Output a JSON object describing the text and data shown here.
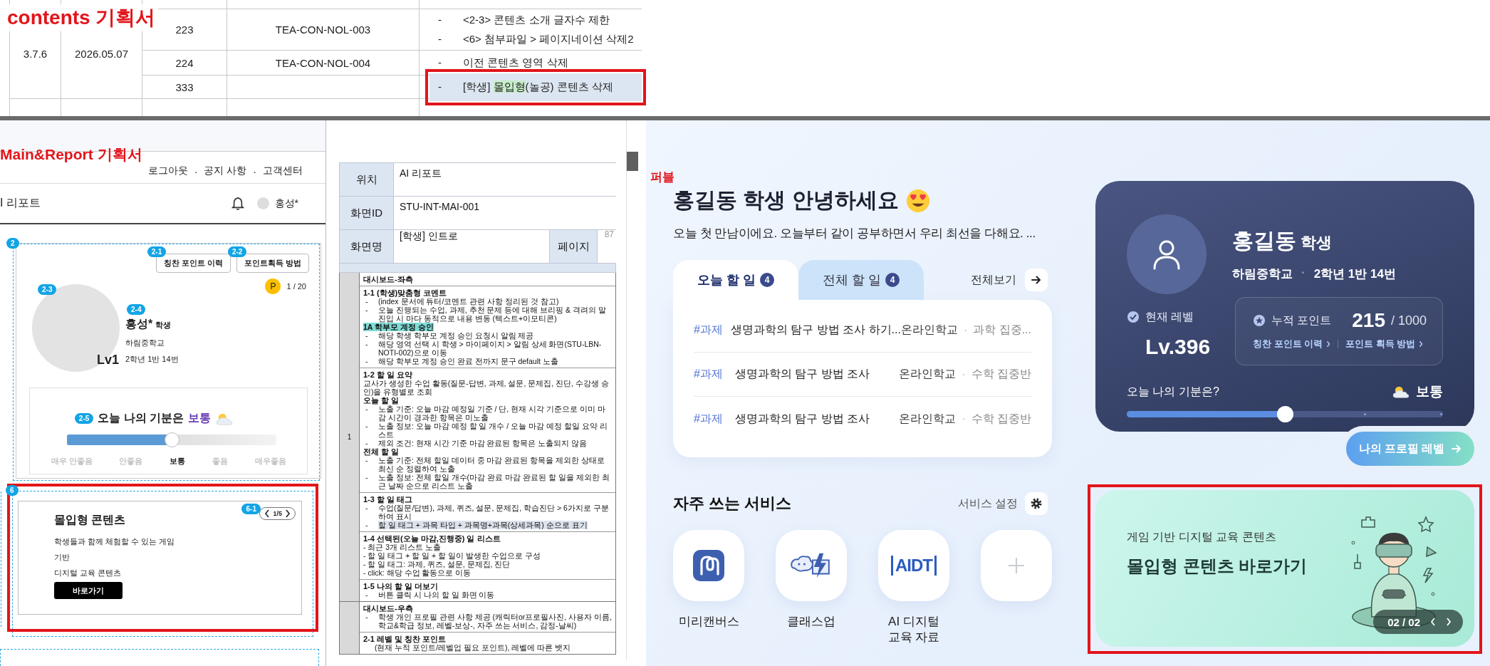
{
  "top_doc": {
    "label": "contents 기획서",
    "version": "3.7.6",
    "date": "2026.05.07",
    "rows": [
      {
        "no": "223",
        "code": "TEA-CON-NOL-003",
        "highlighted": false,
        "changes": [
          {
            "marker": "-",
            "text": "<2-3> 콘텐츠 소개 글자수 제한"
          },
          {
            "marker": "-",
            "text": "<6> 첨부파일 > 페이지네이션 삭제2"
          }
        ]
      },
      {
        "no": "224",
        "code": "TEA-CON-NOL-004",
        "highlighted": false,
        "changes": [
          {
            "marker": "-",
            "text": "이전 콘텐츠 영역 삭제"
          }
        ]
      },
      {
        "no": "333",
        "highlighted": true,
        "changes": [
          {
            "marker": "-",
            "text": "[학생] ",
            "marked": "몰입형",
            "rest": "(놀공) 콘텐츠 삭제"
          }
        ]
      }
    ]
  },
  "wireframe": {
    "label": "Main&Report 기획서",
    "links": [
      "로그아웃",
      "·",
      "공지 사항",
      "·",
      "고객센터"
    ],
    "page_title": "I 리포트",
    "user": "홍성*",
    "profile": {
      "badge": "2",
      "buttons": [
        {
          "badge": "2-1",
          "label": "칭찬 포인트 이력"
        },
        {
          "badge": "2-2",
          "label": "포인트획득 방법"
        }
      ],
      "point_symbol": "P",
      "points": "1 / 20",
      "avatar_badge": "2-3",
      "name_badge": "2-4",
      "name": "홍성*",
      "role": "학생",
      "school": "하림중학교",
      "level": "Lv1",
      "class": "2학년 1반 14번"
    },
    "mood": {
      "badge": "2-5",
      "prompt": "오늘 나의 기분은",
      "value": "보통",
      "level": 0.5,
      "options": [
        {
          "label": "매우 안좋음",
          "selected": false
        },
        {
          "label": "안좋음",
          "selected": false
        },
        {
          "label": "보통",
          "selected": true
        },
        {
          "label": "좋음",
          "selected": false
        },
        {
          "label": "매우좋음",
          "selected": false
        }
      ]
    },
    "content": {
      "badge": "6",
      "pager_badge": "6-1",
      "pager": "1/5",
      "title": "몰입형 콘텐츠",
      "lines": [
        "학생들과 함께 체험할 수 있는 게임",
        "기반",
        "디지털 교육 콘텐츠"
      ],
      "button": "바로가기"
    }
  },
  "spec": {
    "header": [
      {
        "label": "위치",
        "value": "AI 리포트"
      },
      {
        "label": "화면ID",
        "value": "STU-INT-MAI-001"
      }
    ],
    "screen_name": {
      "label": "화면명",
      "value": "[학생] 인트로",
      "page_label": "페이지",
      "page": "87"
    },
    "groups": [
      {
        "number": "1",
        "sections": [
          {
            "lines": [
              {
                "kind": "title",
                "text": "대시보드-좌측"
              }
            ]
          },
          {
            "lines": [
              {
                "kind": "title",
                "text": "1-1 (학생)맞춤형 코멘트"
              },
              {
                "kind": "bullet",
                "marker": "-",
                "text": "(index 문서에 튜터/코멘트 관련 사항 정리된 것 참고)"
              },
              {
                "kind": "bullet",
                "marker": "-",
                "text": "오늘 진행되는 수업, 과제, 추천 문제 등에 대해 브리핑 & 격려의 말 진입 시 마다 동적으로 내용 변동 (텍스트+이모티콘)"
              },
              {
                "kind": "highlight",
                "text": "1A 학부모 계정 승인"
              },
              {
                "kind": "bullet",
                "marker": "-",
                "text": "해당 학생 학부모 계정 승인 요청시 알림 제공"
              },
              {
                "kind": "bullet",
                "marker": "-",
                "text": "해당 영역 선택 시 학생 > 마이페이지 > 알림 상세 화면(STU-LBN-NOTI-002)으로 이동"
              },
              {
                "kind": "bullet",
                "marker": "-",
                "text": "해당 학부모 계정 승인 완료 전까지 문구 default 노출"
              }
            ]
          },
          {
            "lines": [
              {
                "kind": "title",
                "text": "1-2 할 일 요약"
              },
              {
                "kind": "plain",
                "text": "교사가 생성한 수업 활동(질문-답변, 과제, 설문, 문제집, 진단, 수강생 승인)을 유형별로 조회"
              },
              {
                "kind": "title",
                "text": "오늘 할 일"
              },
              {
                "kind": "bullet",
                "marker": "-",
                "text": "노출 기준: 오늘 마감 예정일 기준 / 단, 현재 시각 기준으로 이미 마감 시간이 경과한 항목은 미노출"
              },
              {
                "kind": "bullet",
                "marker": "-",
                "text": "노출 정보: 오늘 마감 예정 할 일 개수 / 오늘 마감 예정 할일 요약 리스트"
              },
              {
                "kind": "bullet",
                "marker": "-",
                "text": "제외 조건: 현재 시간 기준 마감 완료된 항목은 노출되지 않음"
              },
              {
                "kind": "title",
                "text": "전체 할 일"
              },
              {
                "kind": "bullet",
                "marker": "-",
                "text": "노출 기준: 전체 할일 데이터 중 마감 완료된 항목을 제외한 상태로 최신 순 정렬하여 노출"
              },
              {
                "kind": "bullet",
                "marker": "-",
                "text": "노출 정보: 전체 할일 개수(마감 완료 마감 완료된 할 일을 제외한 최근 날짜 순으로 리스트 노출"
              }
            ]
          },
          {
            "lines": [
              {
                "kind": "title",
                "text": "1-3 할 일 태그"
              },
              {
                "kind": "bullet",
                "marker": "-",
                "text": "수업(질문/답변), 과제, 퀴즈, 설문, 문제집, 학습진단 > 6가지로 구분하여 표시"
              },
              {
                "kind": "shaded-bullet",
                "marker": "-",
                "text": "할 일 태그 + 과목 타입 + 과목명+과목(상세과목) 순으로 표기"
              }
            ]
          },
          {
            "lines": [
              {
                "kind": "title",
                "text": "1-4 선택된(오늘 마감,진행중) 일 리스트"
              },
              {
                "kind": "plain",
                "text": "- 최근 3개 리스트 노출"
              },
              {
                "kind": "plain",
                "text": "- 할 일 태그 + 할 일 + 할 일이 발생한 수업으로 구성"
              },
              {
                "kind": "plain",
                "text": "- 할 일 태그: 과제, 퀴즈, 설문, 문제집, 진단"
              },
              {
                "kind": "plain",
                "text": "- click: 해당 수업 활동으로 이동"
              }
            ]
          },
          {
            "lines": [
              {
                "kind": "title",
                "text": "1-5 나의 할 일 더보기"
              },
              {
                "kind": "bullet",
                "marker": "-",
                "text": "버튼 클릭 시 나의 할 일 화면 이동"
              }
            ]
          }
        ]
      },
      {
        "sections": [
          {
            "lines": [
              {
                "kind": "title",
                "text": "대시보드-우측"
              },
              {
                "kind": "bullet",
                "marker": "-",
                "text": "학생 개인 프로필 관련 사항 제공 (캐릭터or프로필사진, 사용자 이름, 학교&학급 정보, 레벨-보상-, 자주 쓰는 서비스, 감정-날씨)"
              }
            ]
          },
          {
            "lines": [
              {
                "kind": "title",
                "text": "2-1 레벨 및 칭찬 포인트"
              },
              {
                "kind": "indent",
                "text": "(현재 누적 포인트/레벨업 필요 포인트), 레벨에 따른 뱃지"
              }
            ]
          }
        ]
      }
    ]
  },
  "app": {
    "label": "퍼블",
    "greeting": "홍길동 학생 안녕하세요",
    "intro": "오늘 첫 만남이에요. 오늘부터 같이 공부하면서 우리 최선을 다해요. ...",
    "tabs": [
      {
        "label": "오늘 할 일",
        "count": "4",
        "selected": true
      },
      {
        "label": "전체 할 일",
        "count": "4",
        "selected": false
      }
    ],
    "view_all": "전체보기",
    "tasks": [
      {
        "tag": "#과제",
        "title": "생명과학의 탐구 방법 조사 하기...",
        "school": "온라인학교",
        "sep": "·",
        "class": "과학 집중..."
      },
      {
        "tag": "#과제",
        "title": "생명과학의 탐구 방법 조사",
        "school": "온라인학교",
        "sep": "·",
        "class": "수학 집중반"
      },
      {
        "tag": "#과제",
        "title": "생명과학의 탐구 방법 조사",
        "school": "온라인학교",
        "sep": "·",
        "class": "수학 집중반"
      }
    ],
    "services": {
      "title": "자주 쓰는 서비스",
      "settings": "서비스 설정",
      "items": [
        {
          "kind": "loop",
          "label": "미리캔버스"
        },
        {
          "kind": "bolt",
          "label": "클래스업"
        },
        {
          "kind": "wordmark",
          "logo_text": "AIDT",
          "label": "AI 디지털 교육 자료"
        },
        {
          "kind": "add"
        }
      ]
    },
    "profile": {
      "name": "홍길동",
      "role": "학생",
      "school": "하림중학교",
      "sep": "·",
      "class": "2학년 1반 14번",
      "level_label": "현재 레벨",
      "level_value": "Lv.396",
      "points_label": "누적 포인트",
      "points": "215",
      "points_total": "/ 1000",
      "links": [
        "칭찬 포인트 이력",
        "포인트 획득 방법"
      ],
      "mood_label": "오늘 나의 기분은?",
      "mood": "보통",
      "mood_slider": {
        "level": 0.5
      },
      "button": "나의 프로필 레벨"
    },
    "banner": {
      "subtitle": "게임 기반 디지털 교육 콘텐츠",
      "title": "몰입형 콘텐츠 바로가기",
      "pager": "02 / 02"
    }
  }
}
